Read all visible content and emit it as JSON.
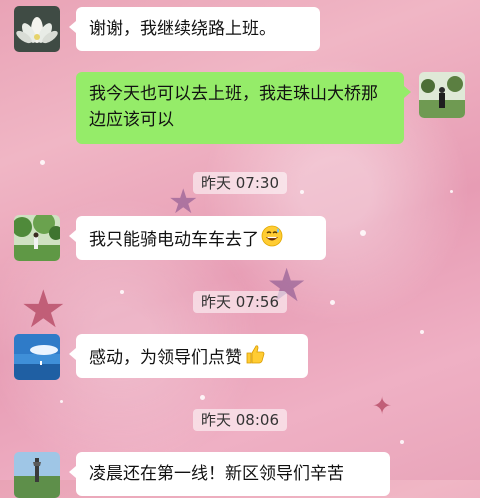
{
  "chat": {
    "messages": [
      {
        "side": "left",
        "text": "谢谢，我继续绕路上班。",
        "avatar": "lotus-avatar"
      },
      {
        "side": "right",
        "text": "我今天也可以去上班，我走珠山大桥那边应该可以",
        "avatar": "person-in-field-avatar"
      },
      {
        "side": "left",
        "text": "我只能骑电动车车去了",
        "emoji": "grinning-sweat-emoji",
        "avatar": "park-avatar"
      },
      {
        "side": "left",
        "text": "感动，为领导们点赞",
        "emoji": "thumbs-up-emoji",
        "avatar": "sea-sky-avatar"
      },
      {
        "side": "left",
        "text": "凌晨还在第一线！新区领导们辛苦",
        "avatar": "tower-avatar"
      }
    ],
    "timestamps": [
      "昨天 07:30",
      "昨天 07:56",
      "昨天 08:06"
    ]
  },
  "colors": {
    "incoming_bubble": "#ffffff",
    "outgoing_bubble": "#95ec69",
    "background": "#eeacc0"
  }
}
